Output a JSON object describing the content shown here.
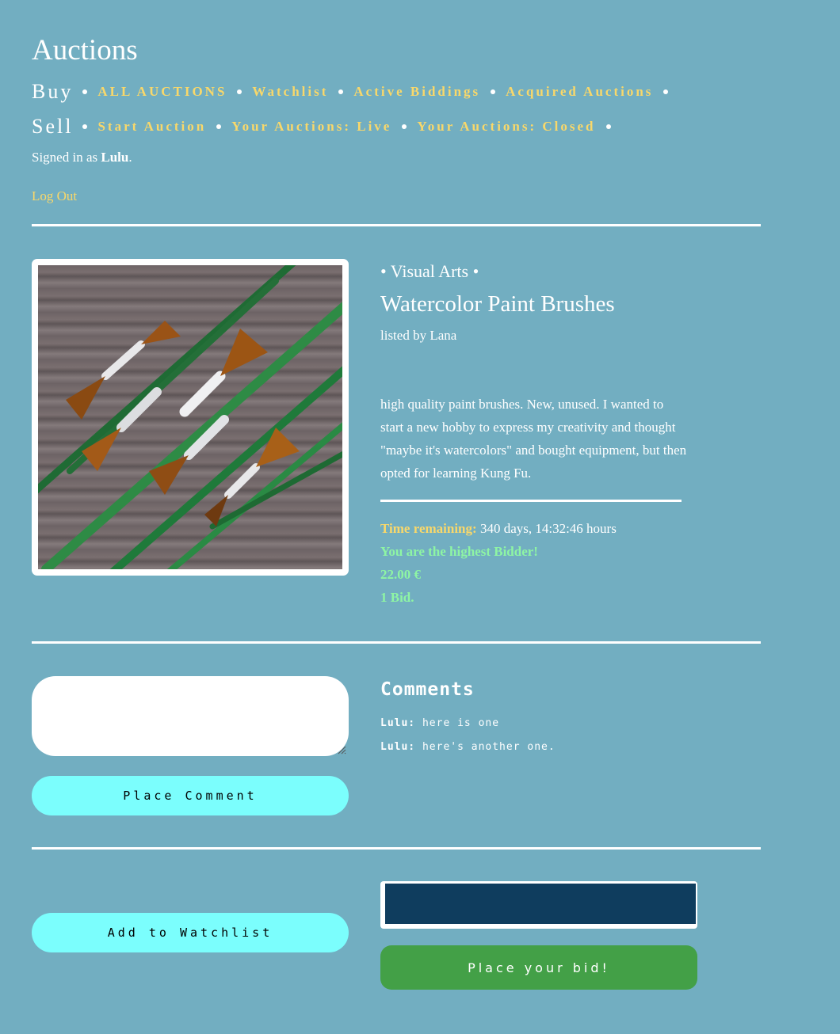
{
  "header": {
    "title": "Auctions",
    "buy_label": "Buy",
    "buy_links": [
      "ALL AUCTIONS",
      "Watchlist",
      "Active Biddings",
      "Acquired Auctions"
    ],
    "sell_label": "Sell",
    "sell_links": [
      "Start Auction",
      "Your Auctions: Live",
      "Your Auctions: Closed"
    ],
    "signed_in_prefix": "Signed in as",
    "username": "Lulu",
    "signed_in_suffix": ".",
    "logout": "Log Out"
  },
  "item": {
    "category": "• Visual Arts •",
    "title": "Watercolor Paint Brushes",
    "listed_by": "listed by Lana",
    "description": "high quality paint brushes. New, unused. I wanted to start a new hobby to express my creativity and thought \"maybe it's watercolors\" and bought equipment, but then opted for learning Kung Fu.",
    "time_label": "Time remaining:",
    "time_value": "340 days, 14:32:46 hours",
    "highest_bidder": "You are the highest Bidder!",
    "price": "22.00 €",
    "bids": "1 Bid."
  },
  "comments": {
    "title": "Comments",
    "input_value": "",
    "place_button": "Place Comment",
    "items": [
      {
        "author": "Lulu:",
        "text": "here is one"
      },
      {
        "author": "Lulu:",
        "text": "here's another one."
      }
    ]
  },
  "actions": {
    "watchlist_button": "Add to Watchlist",
    "bid_input_value": "",
    "bid_button": "Place your bid!"
  },
  "colors": {
    "background": "#72aec1",
    "link": "#f9d86a",
    "highlight_green": "#8ef5a4",
    "pill_button": "#7bfefd",
    "bid_button": "#43a047",
    "bid_input": "#0f3d5e"
  }
}
